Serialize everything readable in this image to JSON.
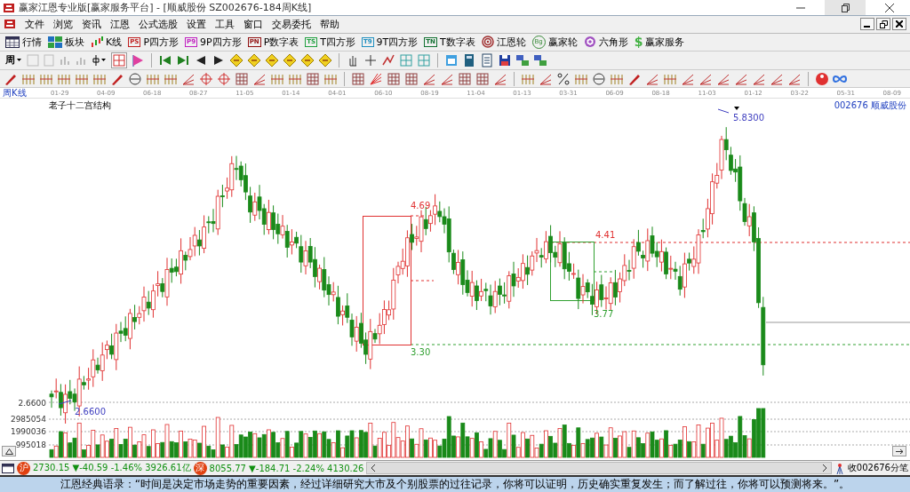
{
  "window": {
    "title": "赢家江恩专业版[赢家服务平台] - [顺威股份  SZ002676-184周K线]"
  },
  "menu": [
    "文件",
    "浏览",
    "资讯",
    "江恩",
    "公式选股",
    "设置",
    "工具",
    "窗口",
    "交易委托",
    "帮助"
  ],
  "toolbar": [
    {
      "label": "行情"
    },
    {
      "label": "板块"
    },
    {
      "label": "K线"
    },
    {
      "label": "P四方形",
      "badge": "PS"
    },
    {
      "label": "9P四方形",
      "badge": "P9"
    },
    {
      "label": "P数字表",
      "badge": "PN"
    },
    {
      "label": "T四方形",
      "badge": "TS"
    },
    {
      "label": "9T四方形",
      "badge": "T9"
    },
    {
      "label": "T数字表",
      "badge": "TN"
    },
    {
      "label": "江恩轮"
    },
    {
      "label": "赢家轮",
      "badge": "Bg"
    },
    {
      "label": "六角形"
    },
    {
      "label": "赢家服务",
      "badge": "$"
    }
  ],
  "period": {
    "value": "周"
  },
  "axis_dates": [
    "01-29",
    "04-09",
    "06-18",
    "08-27",
    "11-05",
    "01-14",
    "04-01",
    "06-10",
    "08-19",
    "11-04",
    "01-13",
    "03-31",
    "06-09",
    "08-18",
    "11-03",
    "01-12",
    "03-22",
    "05-31",
    "08-09"
  ],
  "chart": {
    "period_label": "周K线",
    "title": "老子十二宫结构",
    "stock": "002676 顺威股份",
    "price_axis_label": "2.6600",
    "annotations": [
      {
        "text": "4.69",
        "kind": "red"
      },
      {
        "text": "4.41",
        "kind": "red"
      },
      {
        "text": "3.77",
        "kind": "green"
      },
      {
        "text": "3.30",
        "kind": "green"
      },
      {
        "text": "5.8300",
        "kind": "high"
      },
      {
        "text": "2.6600",
        "kind": "low"
      }
    ],
    "volume_ticks": [
      "2985054",
      "1990036",
      "995018"
    ]
  },
  "status": {
    "indices": [
      {
        "market": "沪",
        "quote": "2730.15 ▼-40.59 -1.46% 3926.61亿"
      },
      {
        "market": "深",
        "quote": "8055.77 ▼-184.71 -2.24% 4130.26"
      }
    ],
    "ticker": "收002676分笔"
  },
  "footer": {
    "quote": "江恩经典语录：“时间是决定市场走势的重要因素，经过详细研究大市及个别股票的过往记录，你将可以证明，历史确实重复发生；而了解过往，你将可以预测将来。”。"
  }
}
